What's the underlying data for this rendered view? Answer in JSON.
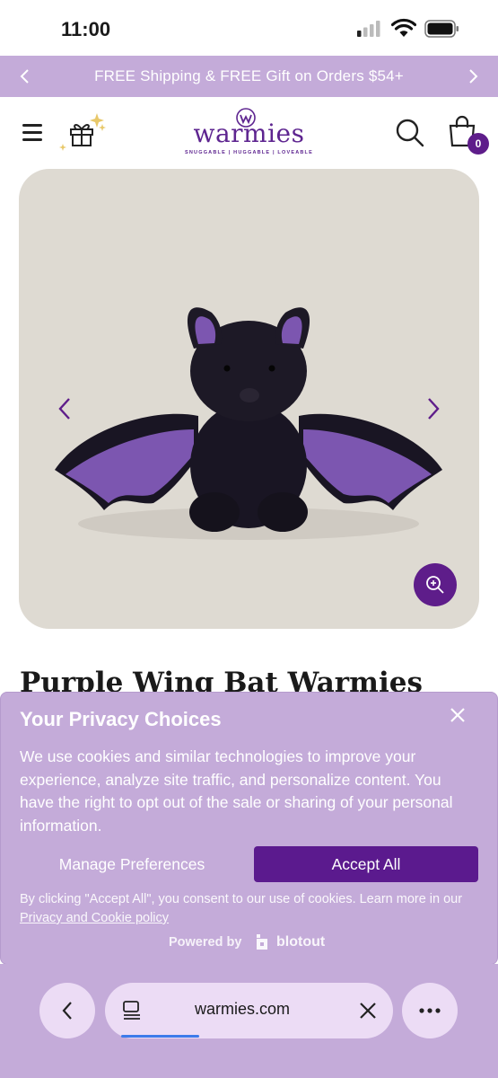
{
  "status_bar": {
    "time": "11:00"
  },
  "promo": {
    "text": "FREE Shipping & FREE Gift on Orders $54+"
  },
  "header": {
    "logo_text": "warmies",
    "logo_tagline": "SNUGGABLE | HUGGABLE | LOVEABLE",
    "cart_count": "0"
  },
  "product": {
    "title": "Purple Wing Bat Warmies"
  },
  "privacy": {
    "title": "Your Privacy Choices",
    "body": "We use cookies and similar technologies to improve your experience, analyze site traffic, and personalize content. You have the right to opt out of the sale or sharing of your personal information.",
    "manage_label": "Manage Preferences",
    "accept_label": "Accept All",
    "note_prefix": "By clicking \"Accept All\", you consent to our use of cookies. Learn more in our ",
    "note_link": "Privacy and Cookie policy",
    "powered_by": "Powered by",
    "vendor": "blotout"
  },
  "browser": {
    "url": "warmies.com"
  },
  "colors": {
    "brand_purple": "#5e1d8a",
    "banner_lilac": "#c4abd9"
  }
}
